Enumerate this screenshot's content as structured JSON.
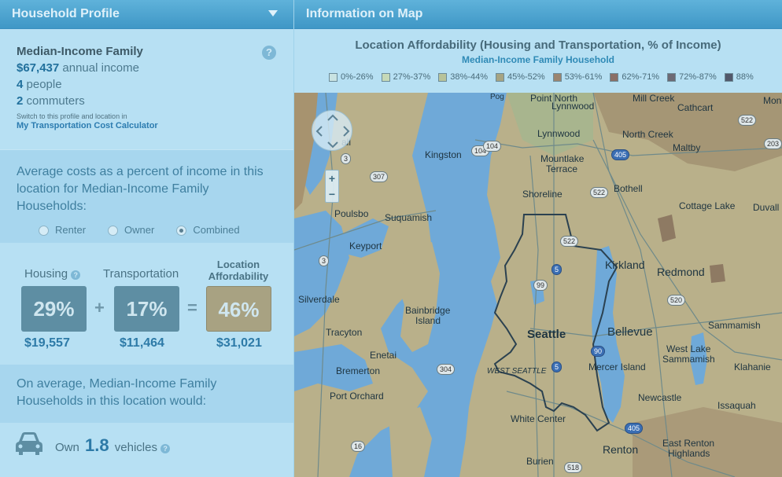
{
  "left_panel": {
    "title": "Household Profile",
    "profile": {
      "name": "Median-Income Family",
      "income": "$67,437",
      "income_label": "annual income",
      "people": "4",
      "people_label": "people",
      "commuters": "2",
      "commuters_label": "commuters",
      "switch_note": "Switch to this profile and location in",
      "link": "My Transportation Cost Calculator",
      "help": "?"
    },
    "avg_costs": {
      "text": "Average costs as a percent of income in this location for Median-Income Family Households:",
      "options": [
        "Renter",
        "Owner",
        "Combined"
      ],
      "selected": "Combined"
    },
    "costs": {
      "housing_label": "Housing",
      "transport_label": "Transportation",
      "la_label_1": "Location",
      "la_label_2": "Affordability",
      "housing_pct": "29%",
      "transport_pct": "17%",
      "la_pct": "46%",
      "housing_amt": "$19,557",
      "transport_amt": "$11,464",
      "la_amt": "$31,021",
      "plus": "+",
      "equals": "=",
      "help": "?"
    },
    "avg_note": "On average, Median-Income Family Households in this location would:",
    "vehicles": {
      "prefix": "Own",
      "value": "1.8",
      "suffix": "vehicles",
      "help": "?"
    }
  },
  "right_panel": {
    "title": "Information on Map",
    "legend": {
      "title": "Location Affordability (Housing and Transportation, % of Income)",
      "subtitle": "Median-Income Family Household",
      "items": [
        {
          "label": "0%-26%",
          "color": "#c9e3e2"
        },
        {
          "label": "27%-37%",
          "color": "#c6d9b8"
        },
        {
          "label": "38%-44%",
          "color": "#b8c39a"
        },
        {
          "label": "45%-52%",
          "color": "#a6a483"
        },
        {
          "label": "53%-61%",
          "color": "#9b8570"
        },
        {
          "label": "62%-71%",
          "color": "#8a6f66"
        },
        {
          "label": "72%-87%",
          "color": "#6d6a74"
        },
        {
          "label": "88%",
          "color": "#52586a"
        }
      ]
    },
    "map_labels": {
      "point_north": "Point North",
      "lynnwood_top": "Lynnwood",
      "mill_creek": "Mill Creek",
      "cathcart": "Cathcart",
      "monroe": "Mon",
      "lynnwood": "Lynnwood",
      "north_creek": "North Creek",
      "maltby": "Maltby",
      "kingston": "Kingston",
      "mountlake": "Mountlake",
      "terrace": "Terrace",
      "shoreline": "Shoreline",
      "bothell": "Bothell",
      "cottage_lake": "Cottage Lake",
      "duvall": "Duvall",
      "poulsbo": "Poulsbo",
      "suquamish": "Suquamish",
      "keyport": "Keyport",
      "kirkland": "Kirkland",
      "redmond": "Redmond",
      "silverdale": "Silverdale",
      "bainbridge": "Bainbridge",
      "island": "Island",
      "tracyton": "Tracyton",
      "seattle": "Seattle",
      "bellevue": "Bellevue",
      "sammamish": "Sammamish",
      "west_lake": "West Lake",
      "west_lake2": "Sammamish",
      "klahanie": "Klahanie",
      "enetai": "Enetai",
      "bremerton": "Bremerton",
      "west_seattle": "WEST SEATTLE",
      "mercer": "Mercer Island",
      "port_orchard": "Port Orchard",
      "newcastle": "Newcastle",
      "issaquah": "Issaquah",
      "white_center": "White Center",
      "renton": "Renton",
      "east_renton": "East Renton",
      "highlands": "Highlands",
      "burien": "Burien",
      "top_cut": "Pog",
      "left_cut": "all"
    },
    "shields": [
      "104",
      "104",
      "405",
      "522",
      "522",
      "203",
      "307",
      "3",
      "3",
      "522",
      "5",
      "99",
      "520",
      "90",
      "304",
      "5",
      "405",
      "16",
      "518"
    ],
    "zoom": {
      "plus": "+",
      "minus": "−"
    }
  }
}
